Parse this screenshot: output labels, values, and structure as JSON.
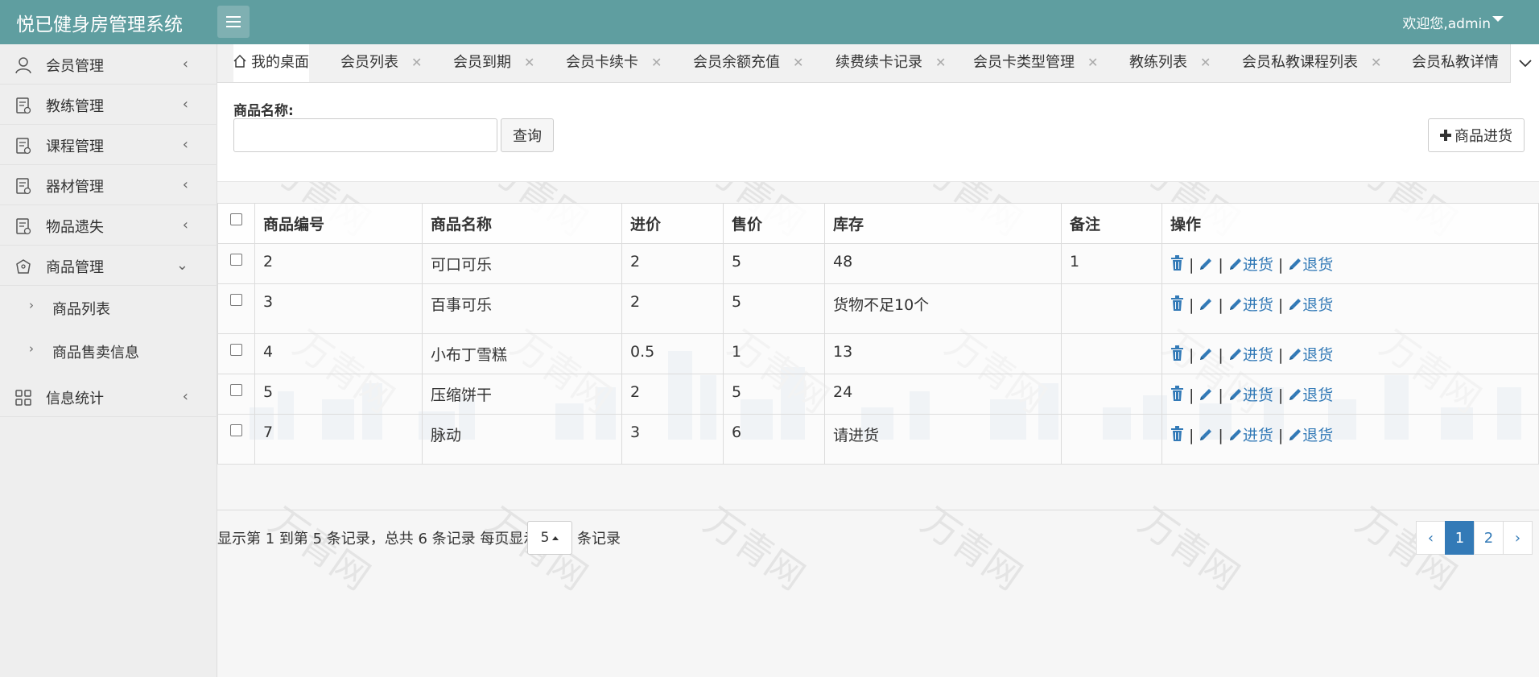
{
  "header": {
    "brand": "悦已健身房管理系统",
    "welcome": "欢迎您,admin"
  },
  "sidebar": {
    "items": [
      {
        "label": "会员管理",
        "icon": "user-icon",
        "arrow": "‹"
      },
      {
        "label": "教练管理",
        "icon": "document-icon",
        "arrow": "‹"
      },
      {
        "label": "课程管理",
        "icon": "document-icon",
        "arrow": "‹"
      },
      {
        "label": "器材管理",
        "icon": "document-icon",
        "arrow": "‹"
      },
      {
        "label": "物品遗失",
        "icon": "document-icon",
        "arrow": "‹"
      },
      {
        "label": "商品管理",
        "icon": "shopping-icon",
        "arrow": "⌄"
      },
      {
        "label": "信息统计",
        "icon": "grid-icon",
        "arrow": "‹"
      }
    ],
    "sub_items": [
      {
        "label": "商品列表",
        "arrow": "›"
      },
      {
        "label": "商品售卖信息",
        "arrow": "›"
      }
    ]
  },
  "tabs": [
    {
      "label": "我的桌面",
      "closable": false
    },
    {
      "label": "会员列表",
      "closable": true
    },
    {
      "label": "会员到期",
      "closable": true
    },
    {
      "label": "会员卡续卡",
      "closable": true
    },
    {
      "label": "会员余额充值",
      "closable": true
    },
    {
      "label": "续费续卡记录",
      "closable": true
    },
    {
      "label": "会员卡类型管理",
      "closable": true
    },
    {
      "label": "教练列表",
      "closable": true
    },
    {
      "label": "会员私教课程列表",
      "closable": true
    },
    {
      "label": "会员私教详情",
      "closable": false
    }
  ],
  "tab_close_glyph": "✕",
  "search": {
    "label": "商品名称:",
    "value": "",
    "placeholder": "",
    "query_button": "查询",
    "stock_button": "商品进货"
  },
  "table": {
    "headers": [
      "商品编号",
      "商品名称",
      "进价",
      "售价",
      "库存",
      "备注",
      "操作"
    ],
    "rows": [
      {
        "id": "2",
        "name": "可口可乐",
        "cost": "2",
        "price": "5",
        "stock": "48",
        "stock_warning": false,
        "note": "1"
      },
      {
        "id": "3",
        "name": "百事可乐",
        "cost": "2",
        "price": "5",
        "stock": "货物不足10个",
        "stock_warning": true,
        "note": ""
      },
      {
        "id": "4",
        "name": "小布丁雪糕",
        "cost": "0.5",
        "price": "1",
        "stock": "13",
        "stock_warning": false,
        "note": ""
      },
      {
        "id": "5",
        "name": "压缩饼干",
        "cost": "2",
        "price": "5",
        "stock": "24",
        "stock_warning": false,
        "note": ""
      },
      {
        "id": "7",
        "name": "脉动",
        "cost": "3",
        "price": "6",
        "stock": "请进货",
        "stock_warning": true,
        "note": ""
      }
    ],
    "actions": {
      "separator": "|",
      "restock": "进货",
      "return": "退货"
    }
  },
  "pagination": {
    "info": "显示第 1 到第 5 条记录，总共 6 条记录 每页显示",
    "page_size": "5",
    "tail": "条记录",
    "prev": "‹",
    "pages": [
      "1",
      "2"
    ],
    "current": "1",
    "next": "›"
  },
  "watermark": "万青网",
  "colors": {
    "header_bg": "#5f9ea0",
    "link": "#337ab7",
    "warning": "#d9232d",
    "sidebar_bg": "#eeeeee"
  }
}
